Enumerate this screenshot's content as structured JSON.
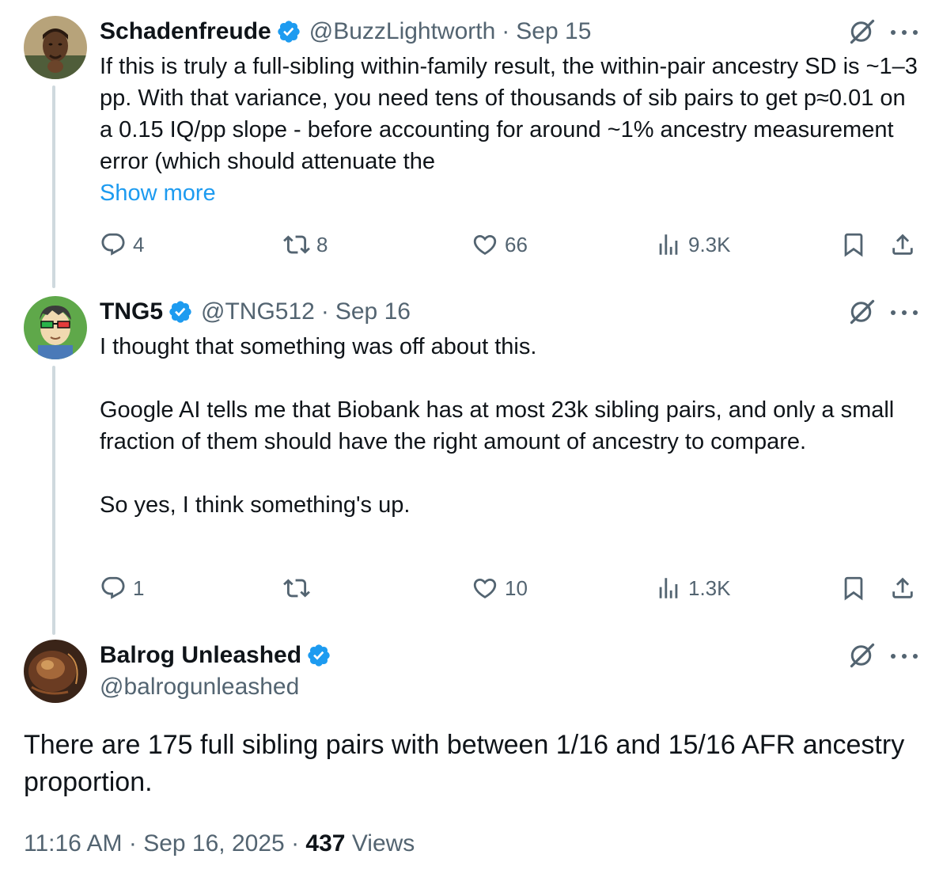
{
  "tweets": [
    {
      "name": "Schadenfreude",
      "handle": "@BuzzLightworth",
      "separator": "·",
      "date": "Sep 15",
      "text": [
        "If this is truly a full-sibling within-family result, the within-pair ancestry SD is ~1–3 pp. With that variance, you need tens of thousands of sib pairs to get p≈0.01 on a 0.15 IQ/pp slope - before accounting for around ~1% ancestry measurement error (which should attenuate the"
      ],
      "show_more": "Show more",
      "replies": "4",
      "reposts": "8",
      "likes": "66",
      "views": "9.3K"
    },
    {
      "name": "TNG5",
      "handle": "@TNG512",
      "separator": "·",
      "date": "Sep 16",
      "text": [
        "I thought that something was off about this.",
        "Google AI tells me that Biobank has at most 23k sibling pairs, and only a small fraction of them should have the right amount of ancestry to compare.",
        "So yes, I think something's up."
      ],
      "replies": "1",
      "reposts": "",
      "likes": "10",
      "views": "1.3K"
    }
  ],
  "main_tweet": {
    "name": "Balrog Unleashed",
    "handle": "@balrogunleashed",
    "text": "There are 175 full sibling pairs with between 1/16 and 15/16 AFR ancestry proportion.",
    "time": "11:16 AM",
    "sep1": "·",
    "date": "Sep 16, 2025",
    "sep2": "·",
    "views_count": "437",
    "views_label": "Views"
  },
  "icons": {
    "verified": "verified-badge-icon",
    "grok": "grok-icon",
    "more": "more-dots-icon",
    "reply": "reply-icon",
    "repost": "repost-icon",
    "like": "heart-icon",
    "views": "views-chart-icon",
    "bookmark": "bookmark-icon",
    "share": "share-icon"
  },
  "colors": {
    "link": "#1d9bf0",
    "secondary_text": "#536471",
    "primary_text": "#0f1419",
    "verified_badge": "#1d9bf0",
    "thread_line": "#cfd9de"
  }
}
